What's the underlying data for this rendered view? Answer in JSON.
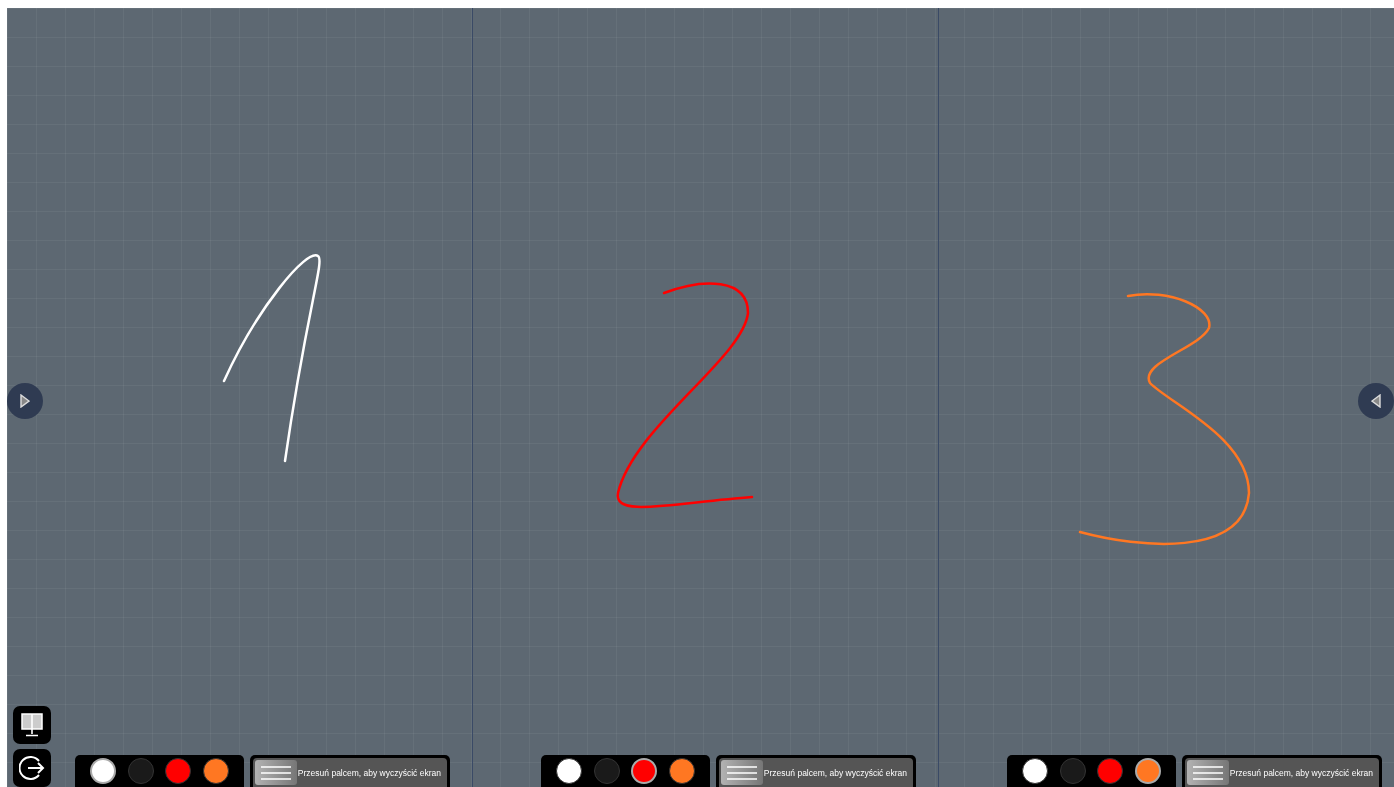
{
  "panels": [
    {
      "color": "#ffffff",
      "swatches": [
        {
          "color": "#ffffff",
          "selected": true
        },
        {
          "color": "#1a1a1a",
          "selected": false
        },
        {
          "color": "#ff0000",
          "selected": false
        },
        {
          "color": "#ff7722",
          "selected": false
        }
      ],
      "clear_slider": {
        "label": "Przesuń palcem, aby wyczyścić ekran",
        "level": 0
      }
    },
    {
      "color": "#ff0000",
      "swatches": [
        {
          "color": "#ffffff",
          "selected": false
        },
        {
          "color": "#1a1a1a",
          "selected": false
        },
        {
          "color": "#ff0000",
          "selected": true
        },
        {
          "color": "#ff7722",
          "selected": false
        }
      ],
      "clear_slider": {
        "label": "Przesuń palcem, aby wyczyścić ekran",
        "level": 0
      }
    },
    {
      "color": "#ff7722",
      "swatches": [
        {
          "color": "#ffffff",
          "selected": false
        },
        {
          "color": "#1a1a1a",
          "selected": false
        },
        {
          "color": "#ff0000",
          "selected": false
        },
        {
          "color": "#ff7722",
          "selected": true
        }
      ],
      "clear_slider": {
        "label": "Przesuń palcem, aby wyczyścić ekran",
        "level": 0
      }
    }
  ]
}
